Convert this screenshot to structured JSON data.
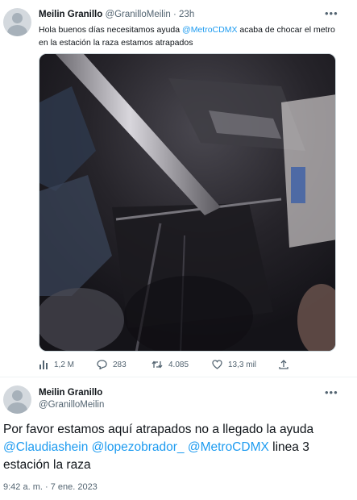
{
  "tweet": {
    "author_name": "Meilin Granillo",
    "author_handle": "@GranilloMeilin",
    "separator": "·",
    "time": "23h",
    "text_before": "Hola buenos días necesitamos ayuda ",
    "mention": "@MetroCDMX",
    "text_after": " acaba de chocar el metro en la estación la raza estamos atrapados",
    "stats": {
      "views": "1,2 M",
      "replies": "283",
      "retweets": "4.085",
      "likes": "13,3 mil"
    }
  },
  "reply": {
    "author_name": "Meilin Granillo",
    "author_handle": "@GranilloMeilin",
    "text_before": "Por favor estamos aquí atrapados no a llegado la ayuda ",
    "mention1": "@Claudiashein",
    "mention2": "@lopezobrador_",
    "mention3": "@MetroCDMX",
    "text_after": " linea 3 estación la raza",
    "timestamp": "9:42 a. m. · 7 ene. 2023"
  },
  "colors": {
    "link": "#1d9bf0",
    "secondary_text": "#536471",
    "primary_text": "#0f1419"
  },
  "icons": [
    "more-icon",
    "views-icon",
    "reply-icon",
    "retweet-icon",
    "like-icon",
    "share-icon",
    "avatar-placeholder"
  ]
}
